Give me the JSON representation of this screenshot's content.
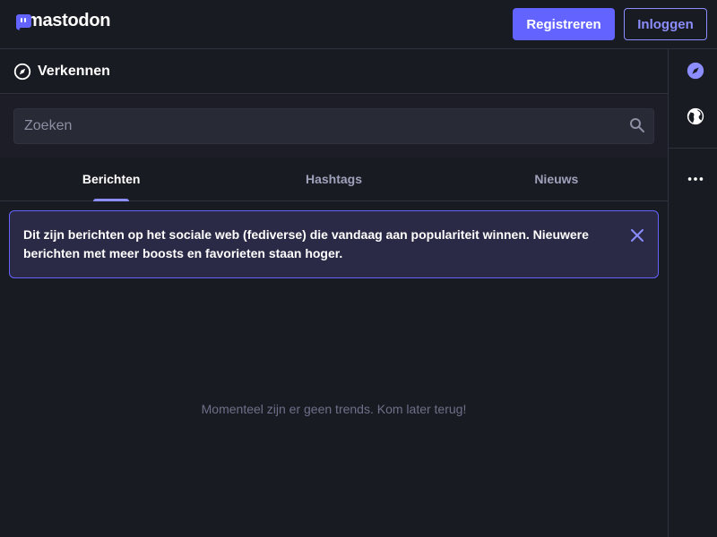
{
  "brand": {
    "name": "mastodon",
    "accent": "#6364ff"
  },
  "header": {
    "register_label": "Registreren",
    "login_label": "Inloggen"
  },
  "column": {
    "icon": "compass-icon",
    "title": "Verkennen"
  },
  "search": {
    "placeholder": "Zoeken",
    "value": ""
  },
  "tabs": [
    {
      "label": "Berichten",
      "active": true
    },
    {
      "label": "Hashtags",
      "active": false
    },
    {
      "label": "Nieuws",
      "active": false
    }
  ],
  "notice": {
    "text": "Dit zijn berichten op het sociale web (fediverse) die vandaag aan populariteit winnen. Nieuwere berichten met meer boosts en favorieten staan hoger."
  },
  "empty_message": "Momenteel zijn er geen trends. Kom later terug!",
  "rail": {
    "items": [
      "compass-icon",
      "globe-icon",
      "more-icon"
    ]
  }
}
